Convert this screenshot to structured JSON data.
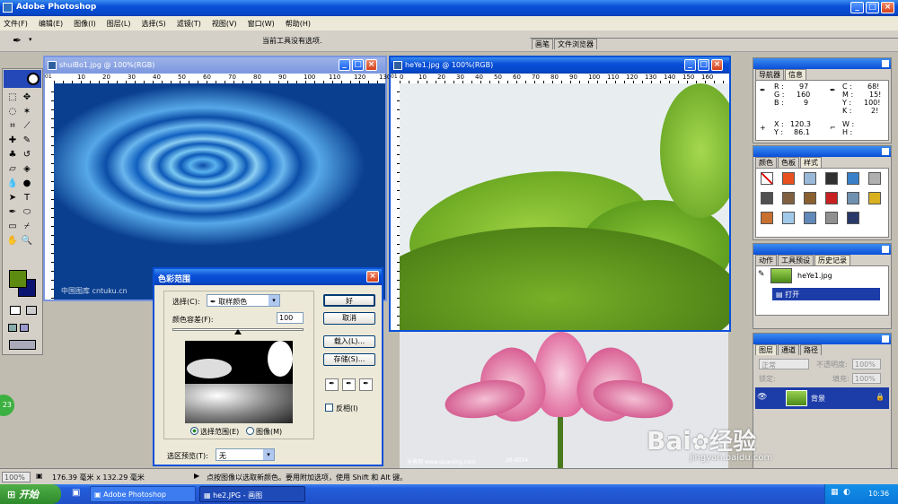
{
  "app": {
    "title": "Adobe Photoshop"
  },
  "menu": [
    "文件(F)",
    "编辑(E)",
    "图像(I)",
    "图层(L)",
    "选择(S)",
    "滤镜(T)",
    "视图(V)",
    "窗口(W)",
    "帮助(H)"
  ],
  "options": {
    "status": "当前工具没有选项.",
    "tab_brush": "画笔",
    "tab_browser": "文件浏览器"
  },
  "doc1": {
    "title": "shuiBo1.jpg @ 100%(RGB)",
    "watermark": "中国图库 cntuku.cn",
    "ruler": [
      "10",
      "20",
      "30",
      "40",
      "50",
      "60",
      "70",
      "80",
      "90",
      "100",
      "110",
      "120",
      "130"
    ]
  },
  "doc2": {
    "title": "heYe1.jpg @ 100%(RGB)",
    "ruler": [
      "0",
      "10",
      "20",
      "30",
      "40",
      "50",
      "60",
      "70",
      "80",
      "90",
      "100",
      "110",
      "120",
      "130",
      "140",
      "150",
      "160"
    ],
    "watermark": "全景网 www.quanjing.com",
    "watermark2": "26-9034"
  },
  "dialog": {
    "title": "色彩范围",
    "select_label": "选择(C):",
    "select_value": "取样颜色",
    "fuzz_label": "颜色容差(F):",
    "fuzz_value": "100",
    "ok": "好",
    "cancel": "取消",
    "load": "载入(L)...",
    "save": "存储(S)...",
    "invert": "反相(I)",
    "opt_selection": "选择范围(E)",
    "opt_image": "图像(M)",
    "preview_label": "选区预览(T):",
    "preview_value": "无"
  },
  "nav": {
    "tab_nav": "导航器",
    "tab_info": "信息",
    "R": "97",
    "G": "160",
    "B": "9",
    "C": "68!",
    "M": "15!",
    "Y": "100!",
    "K": "2!",
    "X": "120.3",
    "Yc": "86.1",
    "lR": "R :",
    "lG": "G :",
    "lB": "B :",
    "lC": "C :",
    "lM": "M :",
    "lY": "Y :",
    "lK": "K :",
    "lX": "X :",
    "lYc": "Y :",
    "lW": "W :",
    "lH": "H :"
  },
  "colors": {
    "tab_color": "颜色",
    "tab_swatch": "色板",
    "tab_style": "样式"
  },
  "history": {
    "tab_action": "动作",
    "tab_preset": "工具预设",
    "tab_history": "历史记录",
    "file": "heYe1.jpg",
    "item": "打开"
  },
  "layers": {
    "tab_layers": "图层",
    "tab_channels": "通道",
    "tab_paths": "路径",
    "blend": "正常",
    "opacity_label": "不透明度:",
    "opacity": "100%",
    "lock_label": "锁定:",
    "fill_label": "填充:",
    "fill": "100%",
    "layer_name": "背景"
  },
  "status": {
    "zoom": "100%",
    "size": "176.39 毫米 x 132.29 毫米",
    "hint": "点按图像以选取新颜色。要用附加选项，使用 Shift 和 Alt 键。"
  },
  "taskbar": {
    "start": "开始",
    "task1": "Adobe Photoshop",
    "task2": "he2.JPG - 画图",
    "time": "10:36"
  },
  "misc": {
    "badge": "23",
    "baidu": "Bai",
    "baidu2": "经验",
    "baidu_url": "jingyan.baidu.com"
  }
}
